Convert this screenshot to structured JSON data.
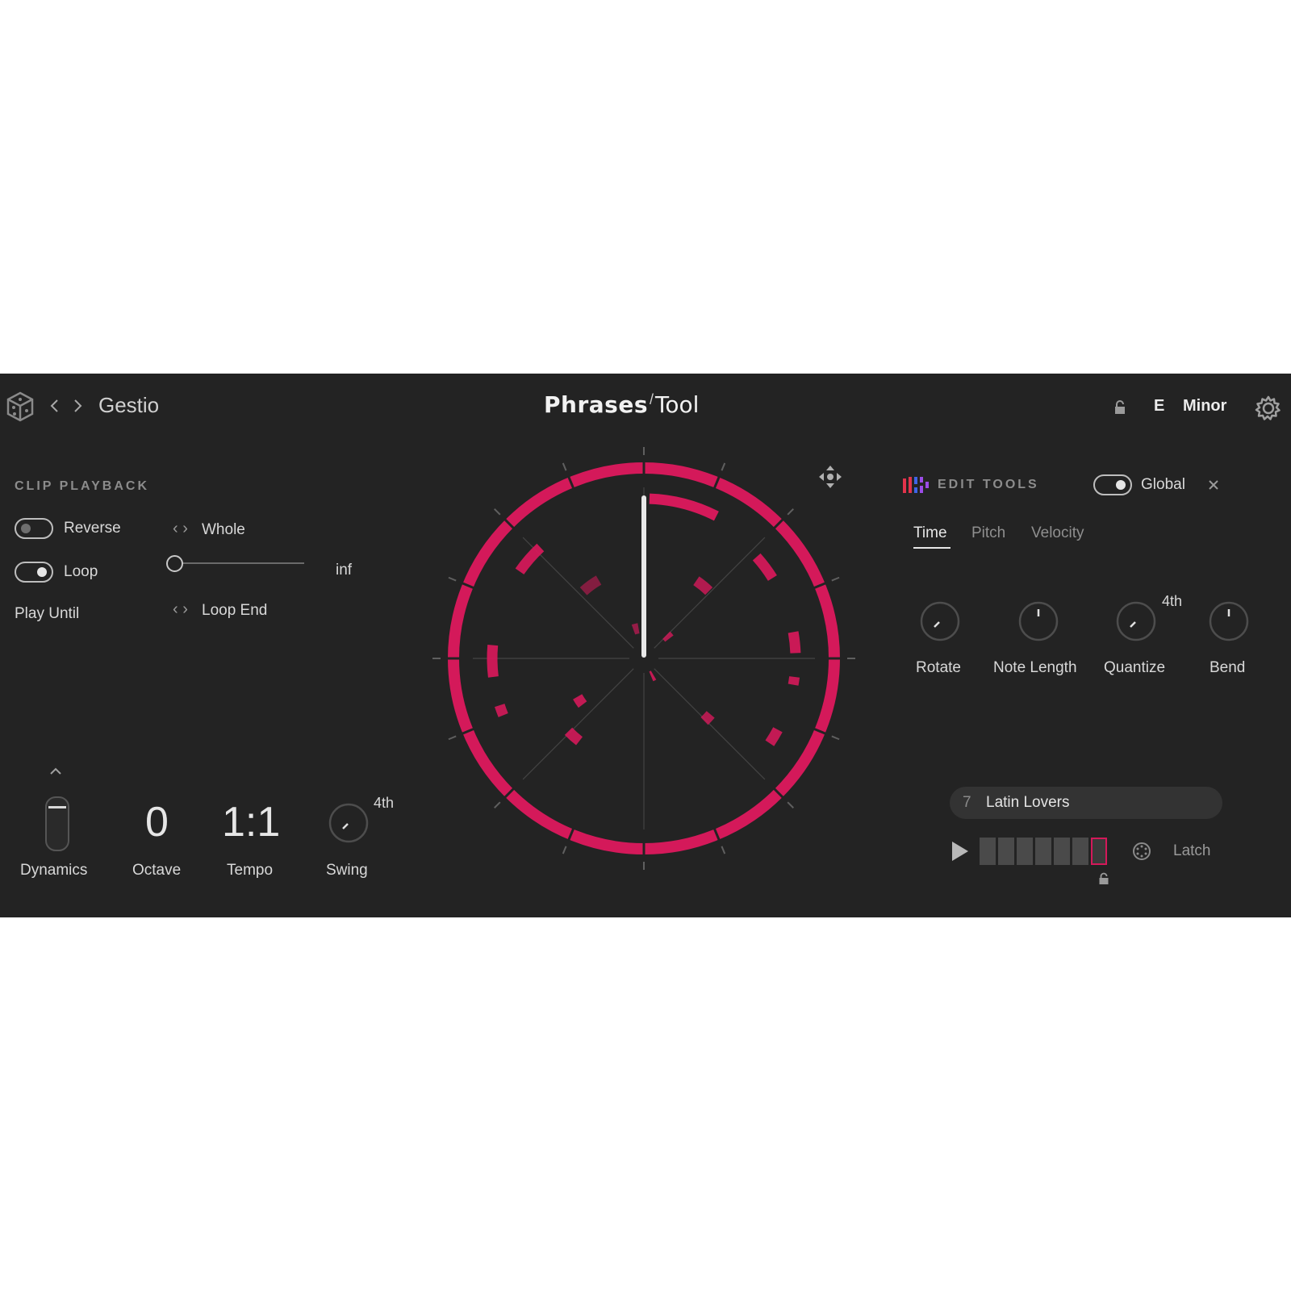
{
  "header": {
    "preset_name": "Gestio",
    "app_title_main": "Phrases",
    "app_title_sub": "Tool",
    "key": "E",
    "scale": "Minor"
  },
  "clip_playback": {
    "heading": "CLIP PLAYBACK",
    "reverse_label": "Reverse",
    "reverse_on": false,
    "range_value": "Whole",
    "loop_label": "Loop",
    "loop_on": true,
    "loop_slider_value": "inf",
    "play_until_label": "Play Until",
    "play_until_value": "Loop End"
  },
  "performance": {
    "dynamics_label": "Dynamics",
    "octave_value": "0",
    "octave_label": "Octave",
    "tempo_value": "1:1",
    "tempo_label": "Tempo",
    "swing_label": "Swing",
    "swing_division": "4th"
  },
  "edit_tools": {
    "heading": "EDIT TOOLS",
    "global_label": "Global",
    "global_on": true,
    "tabs": [
      {
        "label": "Time",
        "active": true
      },
      {
        "label": "Pitch",
        "active": false
      },
      {
        "label": "Velocity",
        "active": false
      }
    ],
    "knobs": [
      {
        "label": "Rotate",
        "extra": ""
      },
      {
        "label": "Note Length",
        "extra": ""
      },
      {
        "label": "Quantize",
        "extra": "4th"
      },
      {
        "label": "Bend",
        "extra": ""
      }
    ]
  },
  "phrase": {
    "number": "7",
    "name": "Latin Lovers",
    "latch_label": "Latch",
    "active_slot": 7,
    "slot_count": 7
  },
  "colors": {
    "accent": "#d4195a",
    "panel_bg": "#232323",
    "text": "#d8d8d8",
    "muted": "#8c8c8c"
  }
}
